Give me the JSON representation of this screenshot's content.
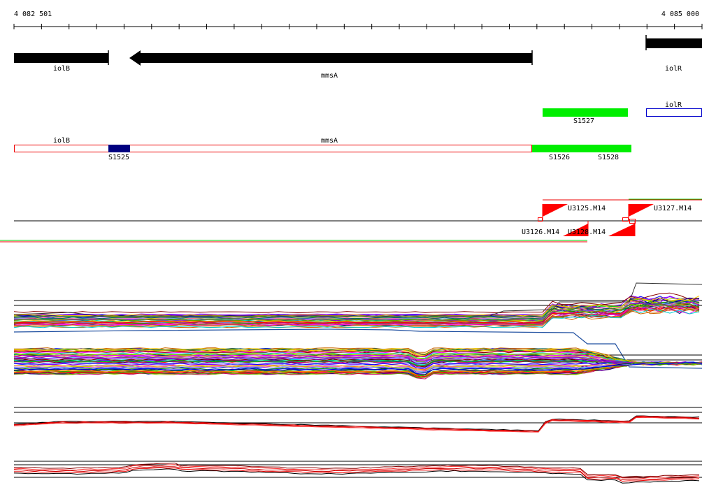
{
  "ruler": {
    "start_label": "4 082 501",
    "end_label": "4 085 000"
  },
  "genes": [
    {
      "name": "iolB",
      "strand": "-"
    },
    {
      "name": "mmsA",
      "strand": "-"
    },
    {
      "name": "iolR",
      "strand": "+"
    }
  ],
  "segments": [
    {
      "name": "iolR",
      "kind": "outline"
    },
    {
      "name": "S1527",
      "kind": "filled"
    },
    {
      "name": "iolB",
      "kind": "outline"
    },
    {
      "name": "S1525",
      "kind": "filled"
    },
    {
      "name": "mmsA",
      "kind": "outline"
    },
    {
      "name": "S1526",
      "kind": "filled"
    },
    {
      "name": "S1528",
      "kind": "filled"
    }
  ],
  "probes": [
    "U3125.M14",
    "U3127.M14",
    "U3126.M14",
    "U3128.M14"
  ],
  "colors": {
    "gene_fill": "#000000",
    "segment_green": "#00ee00",
    "segment_navy": "#000080",
    "outline_red": "#ee0000",
    "outline_blue": "#0000cc",
    "probe_red": "#ff0000"
  },
  "profile_palette": [
    "#ff0000",
    "#00cc00",
    "#0000ff",
    "#ff00ff",
    "#00cccc",
    "#cccc00",
    "#ff8800",
    "#8800ff",
    "#008800",
    "#880000",
    "#000088",
    "#ff66cc",
    "#66aaff",
    "#99cc00",
    "#cc6600",
    "#006666",
    "#9900cc",
    "#ffcc00",
    "#cc0066",
    "#669900"
  ]
}
